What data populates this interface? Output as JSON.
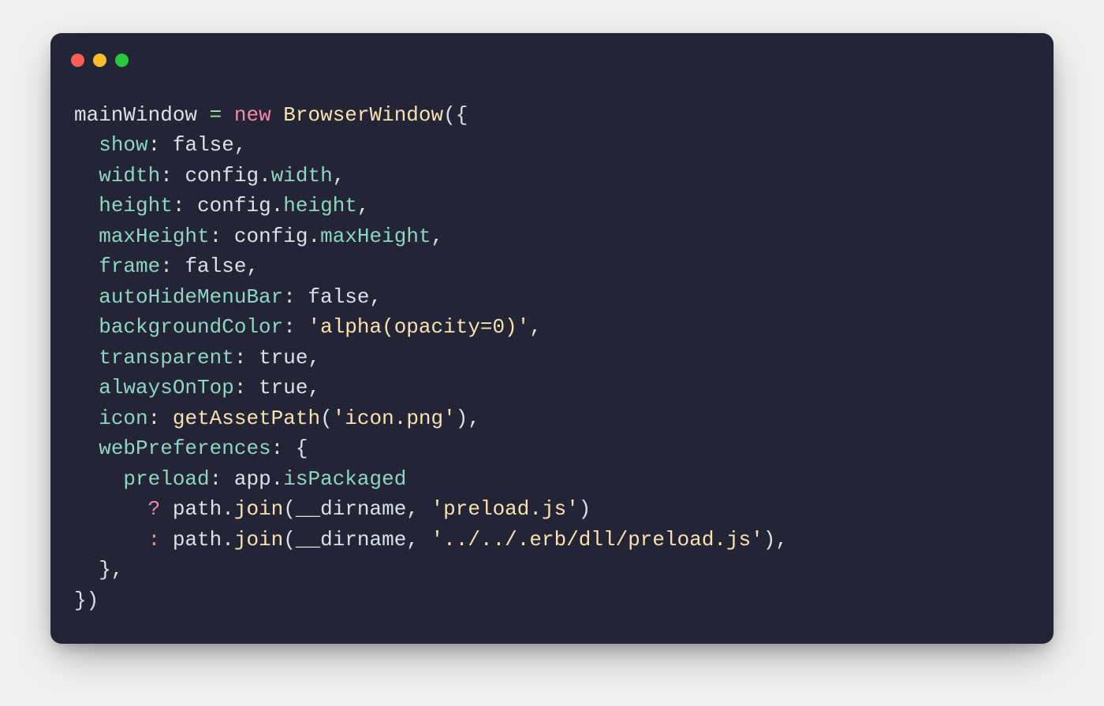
{
  "window": {
    "traffic_lights": [
      "close",
      "minimize",
      "maximize"
    ]
  },
  "colors": {
    "bg": "#232435",
    "default": "#d9e0ee",
    "keyword": "#f38ba8",
    "prop": "#8fd6c2",
    "class": "#f9e2af",
    "string": "#f9e2af",
    "operator": "#a6e3a1"
  },
  "code_plain": "mainWindow = new BrowserWindow({\n  show: false,\n  width: config.width,\n  height: config.height,\n  maxHeight: config.maxHeight,\n  frame: false,\n  autoHideMenuBar: false,\n  backgroundColor: 'alpha(opacity=0)',\n  transparent: true,\n  alwaysOnTop: true,\n  icon: getAssetPath('icon.png'),\n  webPreferences: {\n    preload: app.isPackaged\n      ? path.join(__dirname, 'preload.js')\n      : path.join(__dirname, '../../.erb/dll/preload.js'),\n  },\n})",
  "code_tokens": [
    [
      {
        "t": "mainWindow ",
        "c": "c-default"
      },
      {
        "t": "=",
        "c": "c-op"
      },
      {
        "t": " ",
        "c": "c-default"
      },
      {
        "t": "new",
        "c": "c-keyword"
      },
      {
        "t": " ",
        "c": "c-default"
      },
      {
        "t": "BrowserWindow",
        "c": "c-class"
      },
      {
        "t": "({",
        "c": "c-punct"
      }
    ],
    [
      {
        "t": "  ",
        "c": "c-default"
      },
      {
        "t": "show",
        "c": "c-prop"
      },
      {
        "t": ": ",
        "c": "c-punct"
      },
      {
        "t": "false",
        "c": "c-bool"
      },
      {
        "t": ",",
        "c": "c-punct"
      }
    ],
    [
      {
        "t": "  ",
        "c": "c-default"
      },
      {
        "t": "width",
        "c": "c-prop"
      },
      {
        "t": ": ",
        "c": "c-punct"
      },
      {
        "t": "config",
        "c": "c-default"
      },
      {
        "t": ".",
        "c": "c-punct"
      },
      {
        "t": "width",
        "c": "c-prop"
      },
      {
        "t": ",",
        "c": "c-punct"
      }
    ],
    [
      {
        "t": "  ",
        "c": "c-default"
      },
      {
        "t": "height",
        "c": "c-prop"
      },
      {
        "t": ": ",
        "c": "c-punct"
      },
      {
        "t": "config",
        "c": "c-default"
      },
      {
        "t": ".",
        "c": "c-punct"
      },
      {
        "t": "height",
        "c": "c-prop"
      },
      {
        "t": ",",
        "c": "c-punct"
      }
    ],
    [
      {
        "t": "  ",
        "c": "c-default"
      },
      {
        "t": "maxHeight",
        "c": "c-prop"
      },
      {
        "t": ": ",
        "c": "c-punct"
      },
      {
        "t": "config",
        "c": "c-default"
      },
      {
        "t": ".",
        "c": "c-punct"
      },
      {
        "t": "maxHeight",
        "c": "c-prop"
      },
      {
        "t": ",",
        "c": "c-punct"
      }
    ],
    [
      {
        "t": "  ",
        "c": "c-default"
      },
      {
        "t": "frame",
        "c": "c-prop"
      },
      {
        "t": ": ",
        "c": "c-punct"
      },
      {
        "t": "false",
        "c": "c-bool"
      },
      {
        "t": ",",
        "c": "c-punct"
      }
    ],
    [
      {
        "t": "  ",
        "c": "c-default"
      },
      {
        "t": "autoHideMenuBar",
        "c": "c-prop"
      },
      {
        "t": ": ",
        "c": "c-punct"
      },
      {
        "t": "false",
        "c": "c-bool"
      },
      {
        "t": ",",
        "c": "c-punct"
      }
    ],
    [
      {
        "t": "  ",
        "c": "c-default"
      },
      {
        "t": "backgroundColor",
        "c": "c-prop"
      },
      {
        "t": ": ",
        "c": "c-punct"
      },
      {
        "t": "'alpha(opacity=0)'",
        "c": "c-string"
      },
      {
        "t": ",",
        "c": "c-punct"
      }
    ],
    [
      {
        "t": "  ",
        "c": "c-default"
      },
      {
        "t": "transparent",
        "c": "c-prop"
      },
      {
        "t": ": ",
        "c": "c-punct"
      },
      {
        "t": "true",
        "c": "c-bool"
      },
      {
        "t": ",",
        "c": "c-punct"
      }
    ],
    [
      {
        "t": "  ",
        "c": "c-default"
      },
      {
        "t": "alwaysOnTop",
        "c": "c-prop"
      },
      {
        "t": ": ",
        "c": "c-punct"
      },
      {
        "t": "true",
        "c": "c-bool"
      },
      {
        "t": ",",
        "c": "c-punct"
      }
    ],
    [
      {
        "t": "  ",
        "c": "c-default"
      },
      {
        "t": "icon",
        "c": "c-prop"
      },
      {
        "t": ": ",
        "c": "c-punct"
      },
      {
        "t": "getAssetPath",
        "c": "c-func"
      },
      {
        "t": "(",
        "c": "c-punct"
      },
      {
        "t": "'icon.png'",
        "c": "c-string"
      },
      {
        "t": "),",
        "c": "c-punct"
      }
    ],
    [
      {
        "t": "  ",
        "c": "c-default"
      },
      {
        "t": "webPreferences",
        "c": "c-prop"
      },
      {
        "t": ": {",
        "c": "c-punct"
      }
    ],
    [
      {
        "t": "    ",
        "c": "c-default"
      },
      {
        "t": "preload",
        "c": "c-prop"
      },
      {
        "t": ": ",
        "c": "c-punct"
      },
      {
        "t": "app",
        "c": "c-default"
      },
      {
        "t": ".",
        "c": "c-punct"
      },
      {
        "t": "isPackaged",
        "c": "c-prop"
      }
    ],
    [
      {
        "t": "      ",
        "c": "c-default"
      },
      {
        "t": "?",
        "c": "c-keyword"
      },
      {
        "t": " ",
        "c": "c-default"
      },
      {
        "t": "path",
        "c": "c-default"
      },
      {
        "t": ".",
        "c": "c-punct"
      },
      {
        "t": "join",
        "c": "c-func"
      },
      {
        "t": "(",
        "c": "c-punct"
      },
      {
        "t": "__dirname",
        "c": "c-default"
      },
      {
        "t": ", ",
        "c": "c-punct"
      },
      {
        "t": "'preload.js'",
        "c": "c-string"
      },
      {
        "t": ")",
        "c": "c-punct"
      }
    ],
    [
      {
        "t": "      ",
        "c": "c-default"
      },
      {
        "t": ":",
        "c": "c-keyword"
      },
      {
        "t": " ",
        "c": "c-default"
      },
      {
        "t": "path",
        "c": "c-default"
      },
      {
        "t": ".",
        "c": "c-punct"
      },
      {
        "t": "join",
        "c": "c-func"
      },
      {
        "t": "(",
        "c": "c-punct"
      },
      {
        "t": "__dirname",
        "c": "c-default"
      },
      {
        "t": ", ",
        "c": "c-punct"
      },
      {
        "t": "'../../.erb/dll/preload.js'",
        "c": "c-string"
      },
      {
        "t": "),",
        "c": "c-punct"
      }
    ],
    [
      {
        "t": "  },",
        "c": "c-punct"
      }
    ],
    [
      {
        "t": "})",
        "c": "c-punct"
      }
    ]
  ]
}
